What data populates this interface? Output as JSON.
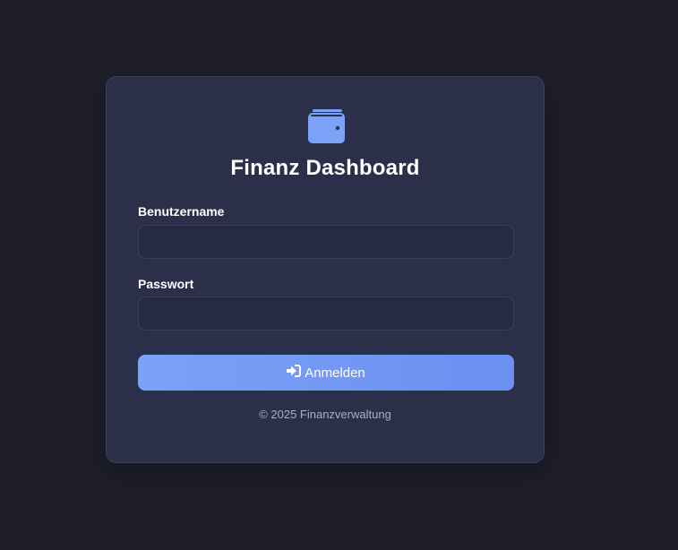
{
  "app": {
    "title": "Finanz Dashboard",
    "logo_icon": "wallet-icon",
    "accent_color": "#6a8ff0"
  },
  "form": {
    "username_label": "Benutzername",
    "username_value": "",
    "username_placeholder": "",
    "password_label": "Passwort",
    "password_value": "",
    "password_placeholder": "",
    "submit_label": "Anmelden",
    "submit_icon": "sign-in-icon"
  },
  "footer": {
    "text": "© 2025 Finanzverwaltung"
  }
}
